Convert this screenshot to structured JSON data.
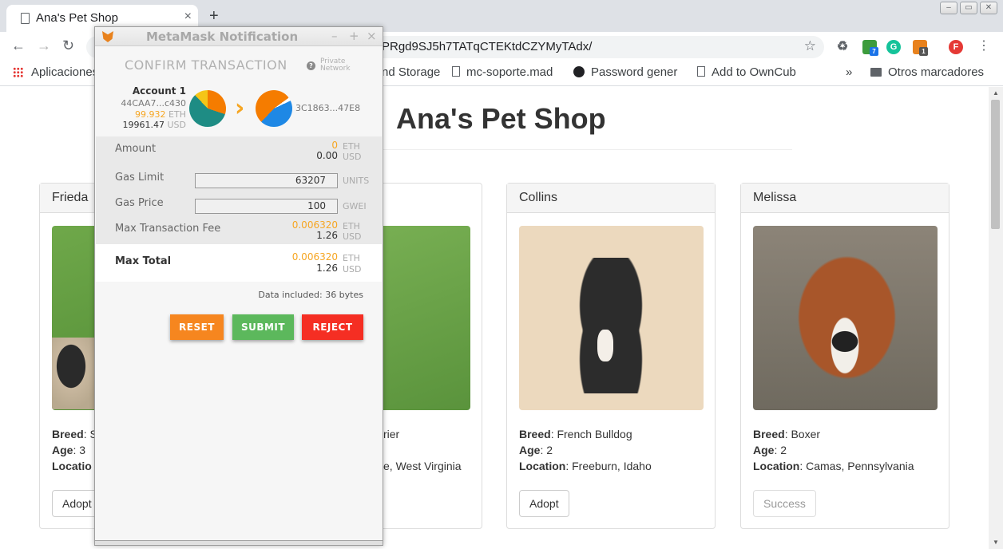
{
  "browser": {
    "tab_title": "Ana's Pet Shop",
    "tab_close": "×",
    "new_tab": "+",
    "url": "PRgd9SJ5h7TATqCTEKtdCZYMyTAdx/",
    "back": "←",
    "forward": "→",
    "reload": "↻",
    "star": "☆",
    "more": "»",
    "profile_letter": "F",
    "ext_badge_1": "7",
    "ext_badge_2": "1",
    "ext_g": "G",
    "window_controls": [
      "–",
      "▭",
      "✕"
    ]
  },
  "bookmarks": {
    "apps": "Aplicaciones",
    "items": [
      "nd Storage",
      "mc-soporte.mad",
      "Password gener",
      "Add to OwnCub"
    ],
    "others": "Otros marcadores"
  },
  "page": {
    "title": "Ana's Pet Shop",
    "pets": [
      {
        "name": "Frieda",
        "breed_label": "Breed",
        "breed": "S",
        "age_label": "Age",
        "age": "3",
        "location_label": "Locatio",
        "location": "",
        "button": "Adopt",
        "button_disabled": false
      },
      {
        "name": "",
        "breed_label": "",
        "breed": "rier",
        "age_label": "",
        "age": "",
        "location_label": "",
        "location": "e, West Virginia",
        "button": "",
        "button_disabled": false
      },
      {
        "name": "Collins",
        "breed_label": "Breed",
        "breed": "French Bulldog",
        "age_label": "Age",
        "age": "2",
        "location_label": "Location",
        "location": "Freeburn, Idaho",
        "button": "Adopt",
        "button_disabled": false
      },
      {
        "name": "Melissa",
        "breed_label": "Breed",
        "breed": "Boxer",
        "age_label": "Age",
        "age": "2",
        "location_label": "Location",
        "location": "Camas, Pennsylvania",
        "button": "Success",
        "button_disabled": true
      }
    ]
  },
  "metamask": {
    "window_title": "MetaMask Notification",
    "controls": [
      "–",
      "+",
      "×"
    ],
    "heading": "CONFIRM TRANSACTION",
    "help": "?",
    "network_line1": "Private",
    "network_line2": "Network",
    "account": {
      "name": "Account 1",
      "address": "44CAA7...c430",
      "eth_balance": "99.932",
      "eth_unit": "ETH",
      "usd_balance": "19961.47",
      "usd_unit": "USD"
    },
    "arrow": "›",
    "destination": "3C1863...47E8",
    "amount": {
      "label": "Amount",
      "eth": "0",
      "eth_unit": "ETH",
      "usd": "0.00",
      "usd_unit": "USD"
    },
    "gas_limit": {
      "label": "Gas Limit",
      "value": "63207",
      "unit": "UNITS"
    },
    "gas_price": {
      "label": "Gas Price",
      "value": "100",
      "unit": "GWEI"
    },
    "max_fee": {
      "label": "Max Transaction Fee",
      "eth": "0.006320",
      "eth_unit": "ETH",
      "usd": "1.26",
      "usd_unit": "USD"
    },
    "max_total": {
      "label": "Max Total",
      "eth": "0.006320",
      "eth_unit": "ETH",
      "usd": "1.26",
      "usd_unit": "USD"
    },
    "data_included": "Data included: 36 bytes",
    "buttons": {
      "reset": "RESET",
      "reset_color": "#f6861f",
      "submit": "SUBMIT",
      "submit_color": "#5cb85c",
      "reject": "REJECT",
      "reject_color": "#f52e23"
    }
  }
}
